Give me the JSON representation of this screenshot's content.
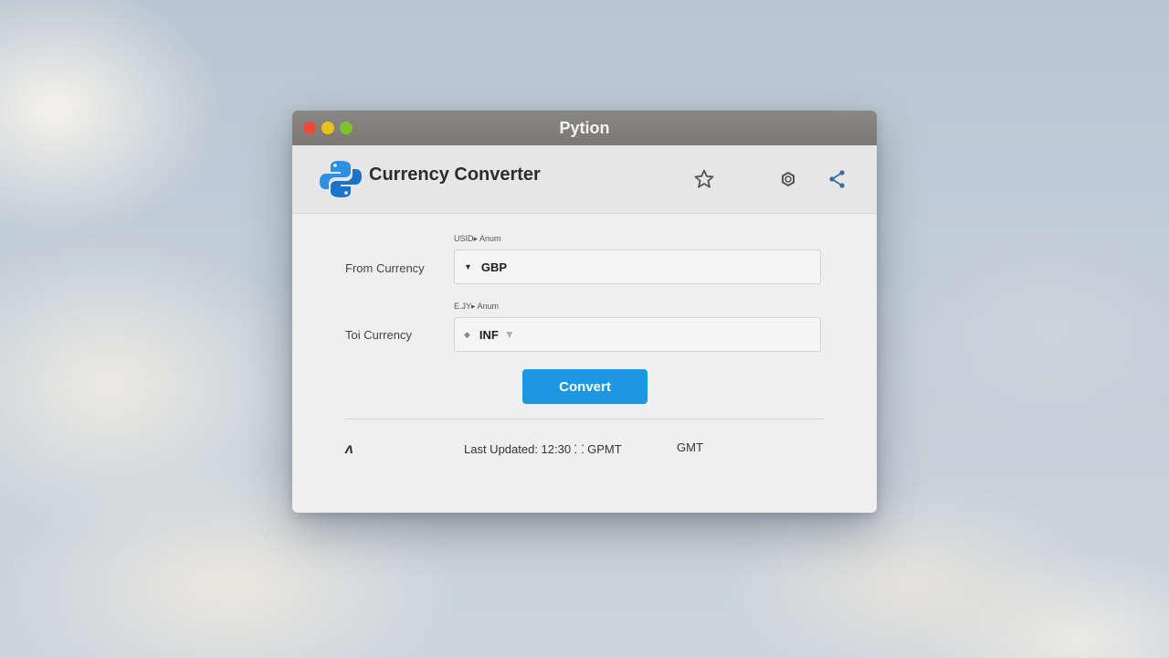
{
  "window": {
    "title": "Pytion"
  },
  "header": {
    "app_title": "Currency Converter",
    "icons": [
      "python-logo",
      "star-icon",
      "gear-icon",
      "share-icon"
    ]
  },
  "form": {
    "from": {
      "label": "From Currency",
      "hint": "USID▸ Anum",
      "value": "GBP"
    },
    "to": {
      "label": "Toi Currency",
      "hint": "E.JY▸ Anum",
      "value": "INF"
    },
    "convert_label": "Convert"
  },
  "footer": {
    "icon_glyph": "ʌ",
    "last_updated": "Last Updated: 12:30 ⸬ GPMT",
    "timezone": "GMT"
  },
  "colors": {
    "accent": "#1e96e0",
    "close": "#e94a3c",
    "minimize": "#e9c21c",
    "maximize": "#7dc22c"
  }
}
